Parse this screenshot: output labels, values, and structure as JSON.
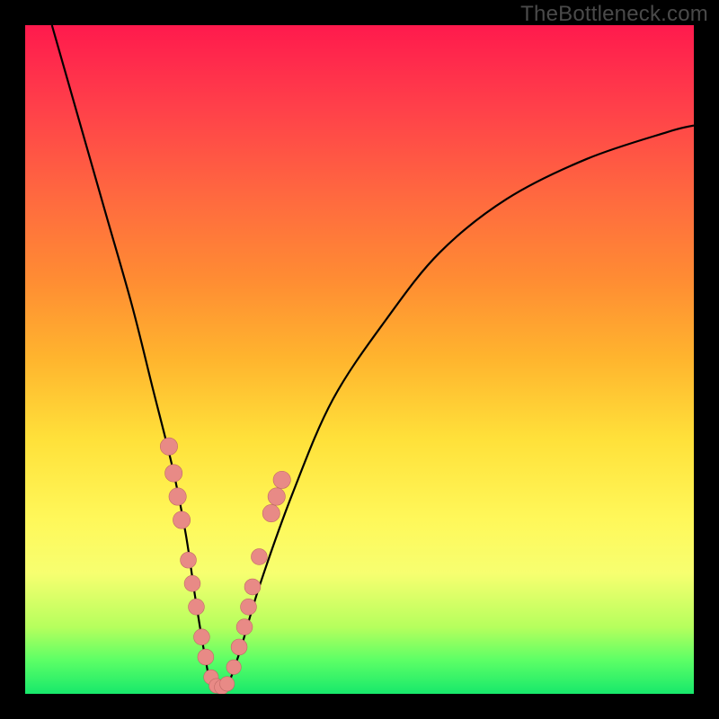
{
  "watermark": "TheBottleneck.com",
  "colors": {
    "background": "#000000",
    "curve": "#000000",
    "marker_fill": "#e88a86",
    "marker_stroke": "#c06a66"
  },
  "chart_data": {
    "type": "line",
    "title": "",
    "xlabel": "",
    "ylabel": "",
    "xlim": [
      0,
      100
    ],
    "ylim": [
      0,
      100
    ],
    "grid": false,
    "legend": false,
    "note": "No axis ticks or numeric labels are rendered; values below are positional estimates (percent of plot width/height, y measured from bottom). The curve is a V-shaped bottleneck profile.",
    "series": [
      {
        "name": "bottleneck-curve",
        "x": [
          4,
          8,
          12,
          16,
          19,
          22,
          24,
          25.5,
          27,
          28,
          30,
          32,
          35,
          40,
          46,
          54,
          62,
          72,
          84,
          96,
          100
        ],
        "y": [
          100,
          86,
          72,
          58,
          46,
          34,
          24,
          14,
          5,
          1,
          1,
          6,
          16,
          30,
          44,
          56,
          66,
          74,
          80,
          84,
          85
        ]
      }
    ],
    "markers": {
      "name": "highlight-points",
      "points": [
        {
          "x": 21.5,
          "y": 37.0,
          "r": 1.3
        },
        {
          "x": 22.2,
          "y": 33.0,
          "r": 1.3
        },
        {
          "x": 22.8,
          "y": 29.5,
          "r": 1.3
        },
        {
          "x": 23.4,
          "y": 26.0,
          "r": 1.3
        },
        {
          "x": 24.4,
          "y": 20.0,
          "r": 1.2
        },
        {
          "x": 25.0,
          "y": 16.5,
          "r": 1.2
        },
        {
          "x": 25.6,
          "y": 13.0,
          "r": 1.2
        },
        {
          "x": 26.4,
          "y": 8.5,
          "r": 1.2
        },
        {
          "x": 27.0,
          "y": 5.5,
          "r": 1.2
        },
        {
          "x": 27.8,
          "y": 2.5,
          "r": 1.1
        },
        {
          "x": 28.6,
          "y": 1.2,
          "r": 1.1
        },
        {
          "x": 29.4,
          "y": 1.0,
          "r": 1.1
        },
        {
          "x": 30.2,
          "y": 1.5,
          "r": 1.1
        },
        {
          "x": 31.2,
          "y": 4.0,
          "r": 1.1
        },
        {
          "x": 32.0,
          "y": 7.0,
          "r": 1.2
        },
        {
          "x": 32.8,
          "y": 10.0,
          "r": 1.2
        },
        {
          "x": 33.4,
          "y": 13.0,
          "r": 1.2
        },
        {
          "x": 34.0,
          "y": 16.0,
          "r": 1.2
        },
        {
          "x": 35.0,
          "y": 20.5,
          "r": 1.2
        },
        {
          "x": 36.8,
          "y": 27.0,
          "r": 1.3
        },
        {
          "x": 37.6,
          "y": 29.5,
          "r": 1.3
        },
        {
          "x": 38.4,
          "y": 32.0,
          "r": 1.3
        }
      ]
    }
  }
}
